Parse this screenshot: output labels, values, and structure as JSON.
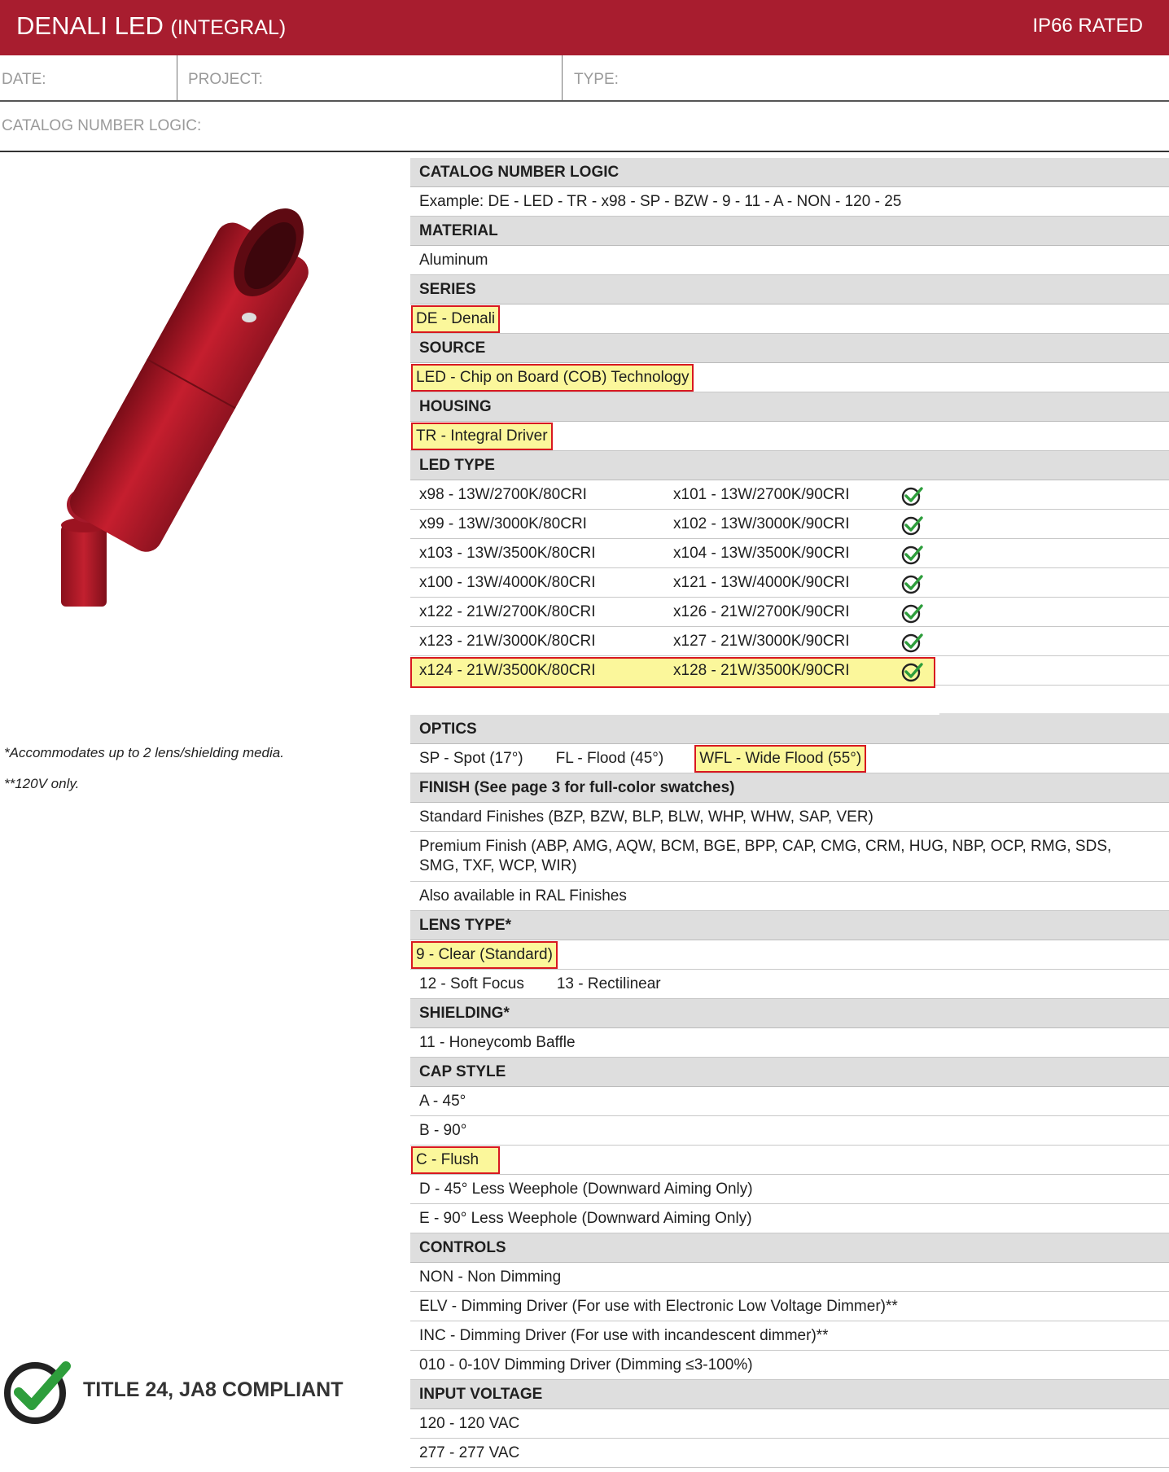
{
  "header": {
    "title_main": "DENALI LED",
    "title_sub": "(INTEGRAL)",
    "rating": "IP66 RATED"
  },
  "info": {
    "date_label": "DATE:",
    "project_label": "PROJECT:",
    "type_label": "TYPE:",
    "catalog_label": "CATALOG NUMBER LOGIC:"
  },
  "notes": {
    "lens_note": "*Accommodates up to 2 lens/shielding media.",
    "voltage_note": "**120V only."
  },
  "compliance": {
    "text": "TITLE 24, JA8 COMPLIANT"
  },
  "colors": {
    "brand": "#a81d2f",
    "highlight": "#fbf79b",
    "highlight_border": "#d81820",
    "check": "#2e9e3c"
  },
  "sections": {
    "catalog": {
      "header": "CATALOG NUMBER LOGIC",
      "example": "Example: DE - LED - TR - x98 - SP - BZW - 9 - 11 - A - NON - 120 - 25"
    },
    "material": {
      "header": "MATERIAL",
      "value": "Aluminum"
    },
    "series": {
      "header": "SERIES",
      "value": "DE - Denali"
    },
    "source": {
      "header": "SOURCE",
      "value": "LED - Chip on Board (COB) Technology"
    },
    "housing": {
      "header": "HOUSING",
      "value": "TR - Integral Driver"
    },
    "led_type": {
      "header": "LED TYPE",
      "rows": [
        [
          "x98 - 13W/2700K/80CRI",
          "x101 - 13W/2700K/90CRI"
        ],
        [
          "x99 - 13W/3000K/80CRI",
          "x102 - 13W/3000K/90CRI"
        ],
        [
          "x103 - 13W/3500K/80CRI",
          "x104 - 13W/3500K/90CRI"
        ],
        [
          "x100 - 13W/4000K/80CRI",
          "x121 - 13W/4000K/90CRI"
        ],
        [
          "x122 - 21W/2700K/80CRI",
          "x126 - 21W/2700K/90CRI"
        ],
        [
          "x123 - 21W/3000K/80CRI",
          "x127 - 21W/3000K/90CRI"
        ],
        [
          "x124 - 21W/3500K/80CRI",
          "x128 - 21W/3500K/90CRI"
        ]
      ]
    },
    "optics": {
      "header": "OPTICS",
      "spot": "SP - Spot (17°)",
      "flood": "FL - Flood (45°)",
      "wide": "WFL - Wide Flood (55°)"
    },
    "finish": {
      "header": "FINISH (See page 3 for full-color swatches)",
      "standard": "Standard Finishes (BZP, BZW, BLP, BLW, WHP, WHW, SAP, VER)",
      "premium": "Premium Finish (ABP, AMG, AQW, BCM, BGE, BPP, CAP, CMG, CRM, HUG, NBP, OCP, RMG, SDS, SMG, TXF, WCP, WIR)",
      "ral": "Also available in RAL Finishes"
    },
    "lens": {
      "header": "LENS TYPE*",
      "clear": "9 - Clear (Standard)",
      "soft": "12 - Soft Focus",
      "rect": "13 - Rectilinear"
    },
    "shielding": {
      "header": "SHIELDING*",
      "value": "11 - Honeycomb Baffle"
    },
    "cap": {
      "header": "CAP STYLE",
      "a": "A - 45°",
      "b": "B - 90°",
      "c": "C - Flush",
      "d": "D - 45° Less Weephole (Downward Aiming Only)",
      "e": "E - 90° Less Weephole (Downward Aiming Only)"
    },
    "controls": {
      "header": "CONTROLS",
      "non": "NON - Non Dimming",
      "elv": "ELV - Dimming Driver (For use with Electronic Low Voltage Dimmer)**",
      "inc": "INC - Dimming Driver (For use with incandescent dimmer)**",
      "ten": "010 - 0-10V Dimming Driver (Dimming ≤3-100%)"
    },
    "voltage": {
      "header": "INPUT VOLTAGE",
      "v120": "120 - 120 VAC",
      "v277": "277 - 277 VAC"
    }
  }
}
